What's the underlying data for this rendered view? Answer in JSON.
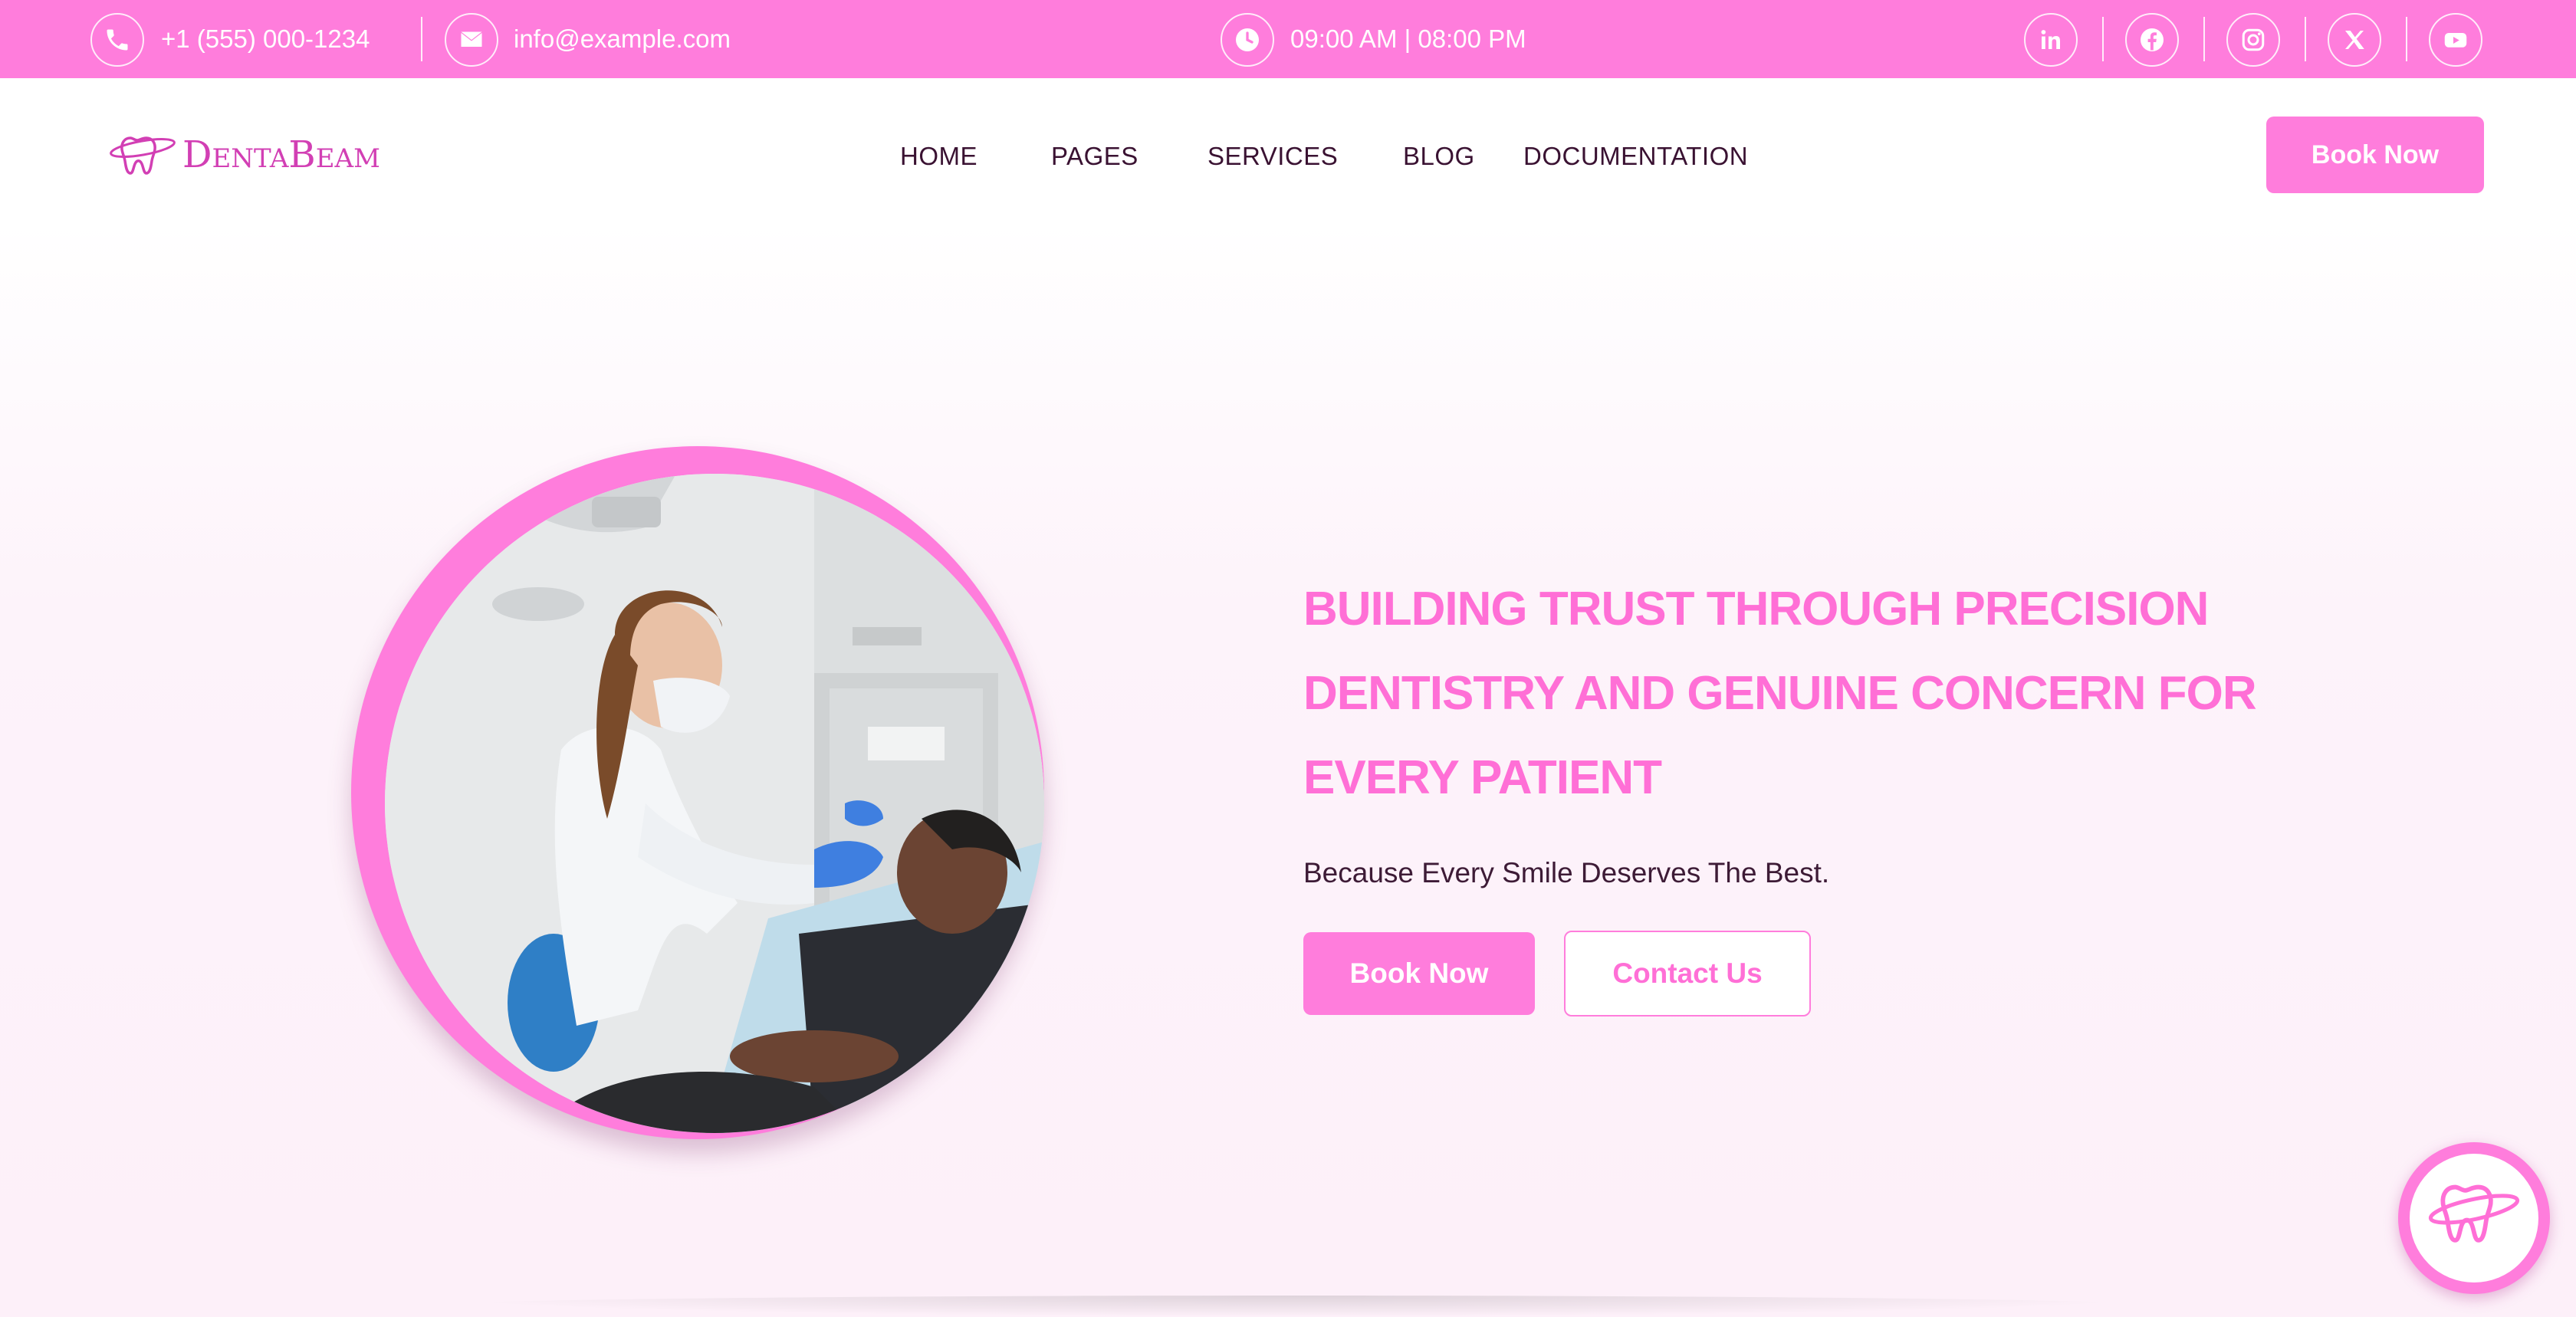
{
  "topbar": {
    "phone": "+1 (555) 000-1234",
    "email": "info@example.com",
    "hours": "09:00 AM | 08:00 PM",
    "phone_icon": "phone-icon",
    "email_icon": "envelope-icon",
    "clock_icon": "clock-icon",
    "social": [
      {
        "name": "linkedin-icon"
      },
      {
        "name": "facebook-icon"
      },
      {
        "name": "instagram-icon"
      },
      {
        "name": "x-twitter-icon"
      },
      {
        "name": "youtube-icon"
      }
    ]
  },
  "brand": {
    "logo_text": "DentaBeam",
    "logo_icon": "tooth-logo-icon"
  },
  "nav": {
    "items": [
      "HOME",
      "PAGES",
      "SERVICES",
      "BLOG",
      "DOCUMENTATION"
    ],
    "cta": "Book Now"
  },
  "hero": {
    "title": "BUILDING TRUST THROUGH PRECISION DENTISTRY AND GENUINE CONCERN FOR EVERY PATIENT",
    "subtitle": "Because Every Smile Deserves The Best.",
    "primary_button": "Book Now",
    "secondary_button": "Contact Us",
    "image_alt": "dentist-treating-patient-photo"
  },
  "fab": {
    "icon": "tooth-chat-icon"
  },
  "colors": {
    "accent": "#ff7ddc",
    "heading": "#ff6fd6",
    "text_dark": "#3a1232"
  }
}
